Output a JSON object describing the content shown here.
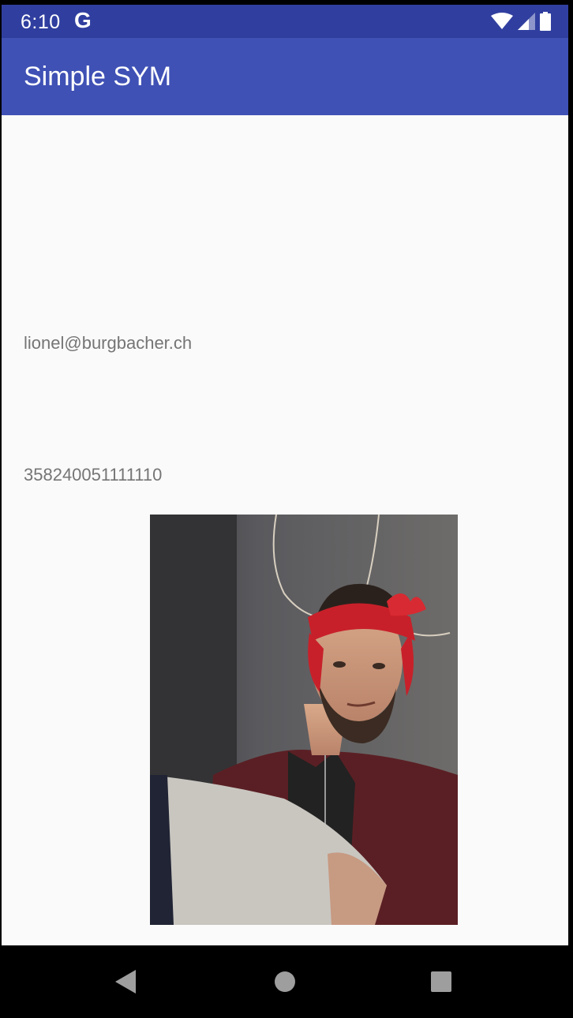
{
  "status_bar": {
    "time": "6:10",
    "google_glyph": "G",
    "icons": [
      "wifi-icon",
      "signal-icon",
      "battery-icon"
    ]
  },
  "app_bar": {
    "title": "Simple SYM"
  },
  "content": {
    "email": "lionel@burgbacher.ch",
    "number": "358240051111110",
    "photo_icon": "profile-photo"
  },
  "nav_bar": {
    "buttons": [
      "back-icon",
      "home-icon",
      "recents-icon"
    ]
  },
  "colors": {
    "status_bar": "#303f9f",
    "app_bar": "#3f51b5",
    "background": "#fafafa",
    "text_secondary": "#757575"
  }
}
